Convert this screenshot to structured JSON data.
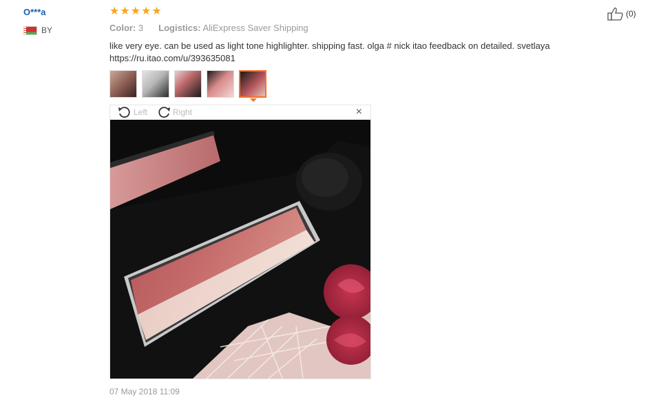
{
  "reviewer": {
    "name": "O***a",
    "country_code": "BY"
  },
  "review": {
    "rating_stars": 5,
    "color_label": "Color:",
    "color_value": "3",
    "logistics_label": "Logistics:",
    "logistics_value": "AliExpress Saver Shipping",
    "text_line1": "like very eye. can be used as light tone highlighter. shipping fast. olga # nick itao feedback on detailed. svetlaya",
    "text_line2": "https://ru.itao.com/u/393635081",
    "date": "07 May 2018 11:09",
    "helpful_count": "(0)"
  },
  "viewer": {
    "rotate_left_label": "Left",
    "rotate_right_label": "Right",
    "close_symbol": "×"
  },
  "thumbnails": {
    "count": 5,
    "active_index": 4
  },
  "colors": {
    "star": "#f5a623",
    "username": "#1a5fa8",
    "active_thumb_border": "#f57224"
  },
  "icons": [
    "star-icon",
    "flag-icon",
    "rotate-left-icon",
    "rotate-right-icon",
    "close-icon",
    "thumbs-up-icon"
  ]
}
